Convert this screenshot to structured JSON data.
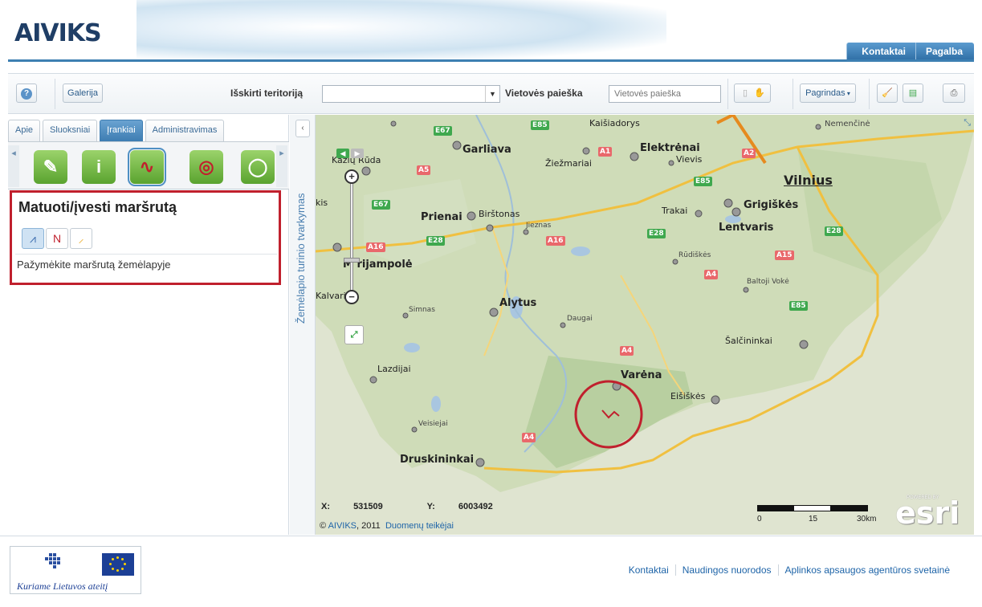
{
  "header": {
    "logo": "AIVIKS",
    "links": [
      "Kontaktai",
      "Pagalba"
    ]
  },
  "toolbar": {
    "help_icon": "help-icon",
    "gallery": "Galerija",
    "territory_label": "Išskirti teritoriją",
    "territory_value": "",
    "search_label": "Vietovės paieška",
    "search_placeholder": "Vietovės paieška",
    "basemap": "Pagrindas"
  },
  "left_panel": {
    "tabs": [
      "Apie",
      "Sluoksniai",
      "Įrankiai",
      "Administravimas"
    ],
    "active_tab": "Įrankiai",
    "tools": [
      "ruler-icon",
      "info-icon",
      "route-icon",
      "compass-icon",
      "search-map-icon"
    ],
    "measure": {
      "title": "Matuoti/įvesti maršrutą",
      "hint": "Pažymėkite maršrutą žemėlapyje"
    }
  },
  "side_strip": {
    "label": "Žemėlapio turinio tvarkymas"
  },
  "map": {
    "cities": {
      "vilnius": "Vilnius",
      "grigiskes": "Grigiškės",
      "lentvaris": "Lentvaris",
      "trakai": "Trakai",
      "elektrenai": "Elektrėnai",
      "vievis": "Vievis",
      "kaisiadorys": "Kaišiadorys",
      "nemencine": "Nemenčinė",
      "garliava": "Garliava",
      "kazlu_ruda": "Kazlų Rūda",
      "ziezmariai": "Žiežmariai",
      "prienai": "Prienai",
      "birstonas": "Birštonas",
      "jieznas": "Jieznas",
      "marijampole": "M  rijampolė",
      "kalvarija": "Kalvarij",
      "kis": "kis",
      "alytus": "Alytus",
      "simnas": "Simnas",
      "daugai": "Daugai",
      "rudiskes": "Rūdiškės",
      "baltoji_voke": "Baltoji Vokė",
      "salcininkai": "Šalčininkai",
      "varena": "Varėna",
      "eisiskes": "Eišiškės",
      "lazdijai": "Lazdijai",
      "veisiejai": "Veisiejai",
      "druskininkai": "Druskininkai"
    },
    "roads": {
      "e67a": "E67",
      "e85a": "E85",
      "a1": "A1",
      "a2": "A2",
      "a5": "A5",
      "e85b": "E85",
      "e67b": "E67",
      "a16a": "A16",
      "e28a": "E28",
      "a16b": "A16",
      "e28b": "E28",
      "a15": "A15",
      "e28c": "E28",
      "a4a": "A4",
      "e85c": "E85",
      "a4b": "A4",
      "a4c": "A4"
    },
    "coords": {
      "x_label": "X:",
      "x": "531509",
      "y_label": "Y:",
      "y": "6003492"
    },
    "copyright_prefix": "© ",
    "copyright_link": "AIVIKS",
    "copyright_year": ", 2011",
    "providers_link": "Duomenų teikėjai",
    "scale": {
      "l0": "0",
      "l15": "15",
      "l30": "30km"
    },
    "esri": "esri",
    "powered_by": "POWERED BY"
  },
  "footer": {
    "motto": "Kuriame Lietuvos ateitį",
    "links": [
      "Kontaktai",
      "Naudingos nuorodos",
      "Aplinkos apsaugos agentūros svetainė"
    ]
  }
}
